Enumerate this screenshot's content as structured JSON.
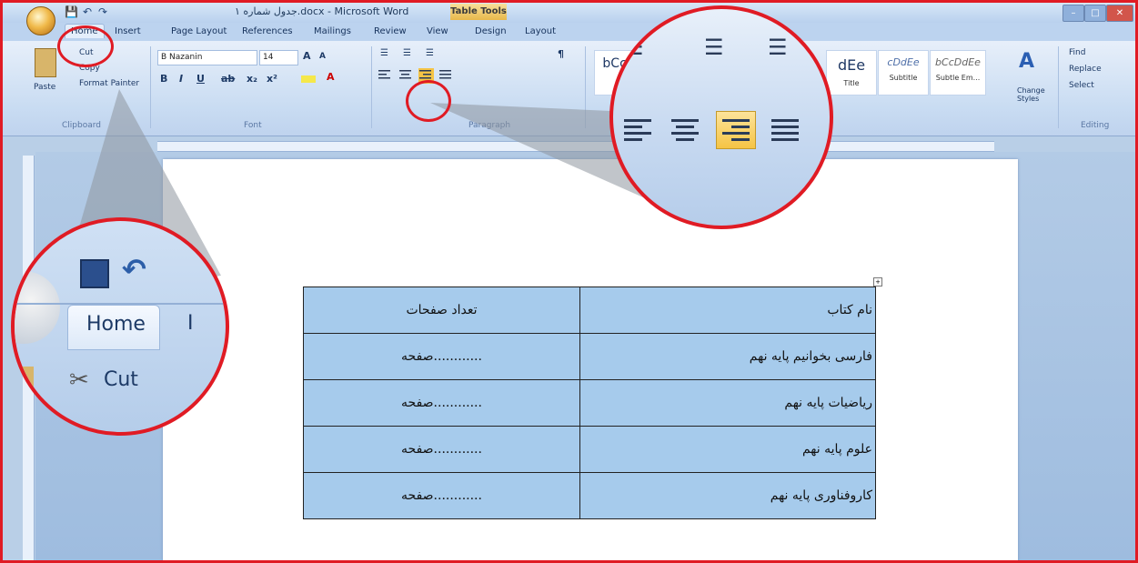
{
  "title_bar": {
    "document_title": "جدول شماره ۱.docx - Microsoft Word",
    "context_tab": "Table Tools"
  },
  "tabs": [
    "Home",
    "Insert",
    "Page Layout",
    "References",
    "Mailings",
    "Review",
    "View",
    "Design",
    "Layout"
  ],
  "clipboard": {
    "paste": "Paste",
    "cut": "Cut",
    "copy": "Copy",
    "format_painter": "Format Painter",
    "group": "Clipboard"
  },
  "font": {
    "name": "B Nazanin",
    "size": "14",
    "group": "Font"
  },
  "paragraph": {
    "group": "Paragraph"
  },
  "styles": {
    "title": "Title",
    "subtitle": "Subtitle",
    "subtle_emphasis": "Subtle Em...",
    "change_styles": "Change Styles"
  },
  "editing": {
    "find": "Find",
    "replace": "Replace",
    "select": "Select",
    "group": "Editing"
  },
  "magnifier_left": {
    "home_tab": "Home",
    "cut": "Cut"
  },
  "table": {
    "rows": [
      [
        "نام کتاب",
        "تعداد صفحات"
      ],
      [
        "فارسی  بخوانیم پایه نهم",
        "............صفحه"
      ],
      [
        "ریاضیات پایه نهم",
        "............صفحه"
      ],
      [
        "علوم پایه نهم",
        "............صفحه"
      ],
      [
        "کاروفناوری پایه نهم",
        "............صفحه"
      ]
    ]
  },
  "colors": {
    "highlight_red": "#e01b24",
    "table_fill": "#a6cbec",
    "active_align": "#f5c445"
  }
}
